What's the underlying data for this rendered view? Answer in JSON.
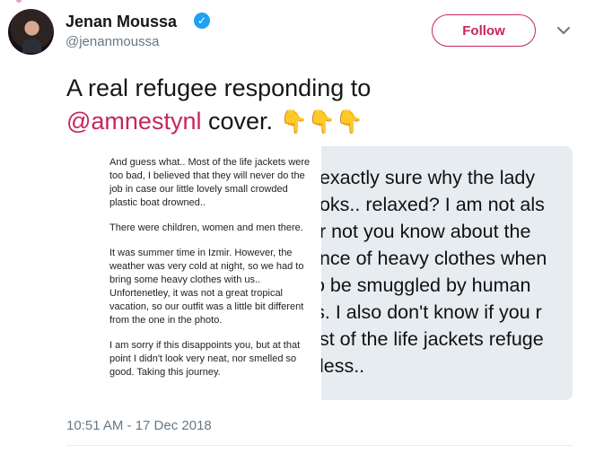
{
  "author": {
    "name": "Jenan Moussa",
    "handle": "@jenanmoussa"
  },
  "follow_label": "Follow",
  "tweet": {
    "text_before": "A real refugee responding to",
    "mention": "@amnestynl",
    "text_after": " cover. ",
    "emojis": "👇👇👇"
  },
  "image": {
    "left_card_paragraphs": [
      "And guess what.. Most of the life jackets were too bad, I believed that they will never do the job in case our little lovely small crowded plastic boat drowned..",
      "There were children, women and men there.",
      "It was summer time in Izmir. However, the weather was very cold at night, so we had to bring some heavy clothes with us.. Unfortenetley, it was not a great tropical vacation, so our outfit was a little bit different from the one in the photo.",
      "I am sorry if this disappoints you, but at that point I didn't look very neat, nor smelled so good. Taking this journey."
    ],
    "right_lines": [
      "t exactly sure why the lady",
      "ooks.. relaxed? I am not als",
      "or not you know about the",
      "ance of heavy clothes when",
      "to be smuggled by human",
      "rs. I also don't know if you r",
      "ost of the life jackets refuge",
      "eless.."
    ]
  },
  "timestamp": "10:51 AM - 17 Dec 2018"
}
